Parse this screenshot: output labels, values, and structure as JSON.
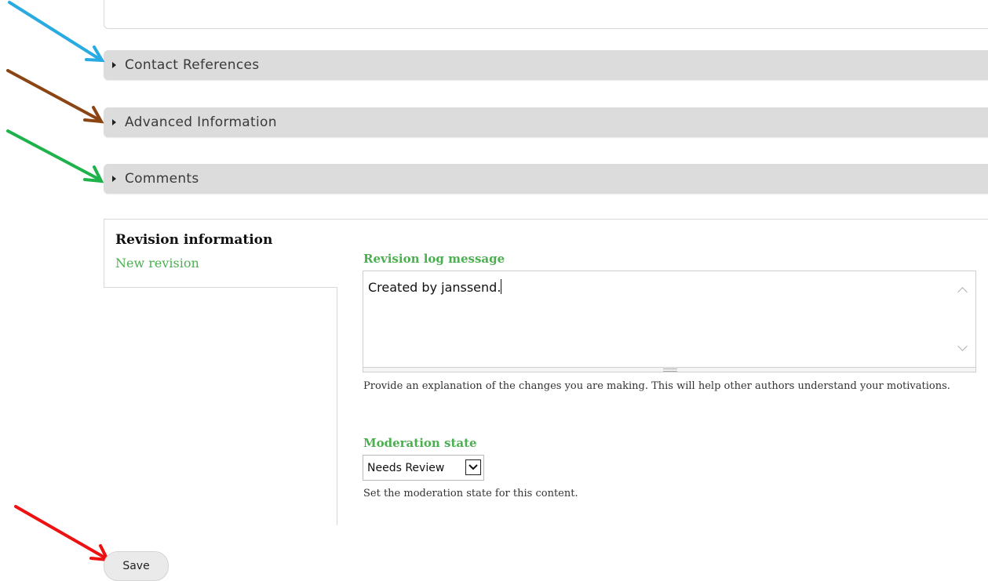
{
  "sections": {
    "contact": "Contact References",
    "advanced": "Advanced Information",
    "comments": "Comments"
  },
  "revision": {
    "tab_title": "Revision information",
    "tab_summary": "New revision",
    "log_label": "Revision log message",
    "log_value": "Created by janssend.",
    "log_description": "Provide an explanation of the changes you are making. This will help other authors understand your motivations.",
    "moderation_label": "Moderation state",
    "moderation_value": "Needs Review",
    "moderation_description": "Set the moderation state for this content."
  },
  "actions": {
    "save": "Save"
  },
  "colors": {
    "accent_green": "#4caf50",
    "arrow_blue": "#29abe2",
    "arrow_brown": "#8b4513",
    "arrow_green": "#1db34a",
    "arrow_red": "#ee1111"
  },
  "icons": [
    "triangle-right-icon",
    "chevron-up-icon",
    "chevron-down-icon",
    "arrow-annotation"
  ]
}
